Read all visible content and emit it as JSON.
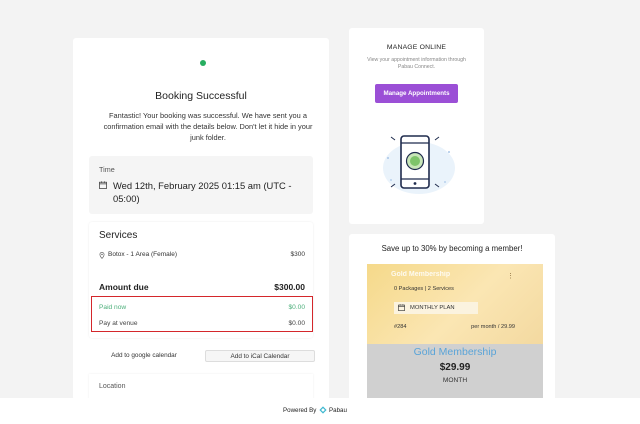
{
  "booking": {
    "title": "Booking Successful",
    "message": "Fantastic! Your booking was successful. We have sent you a confirmation email with the details below. Don't let it hide in your junk folder.",
    "time_label": "Time",
    "time_value": "Wed 12th,  February 2025 01:15 am (UTC - 05:00)",
    "services_title": "Services",
    "service": {
      "name": "Botox - 1 Area (Female)",
      "price": "$300"
    },
    "amount_due_label": "Amount due",
    "amount_due_value": "$300.00",
    "paid_now_label": "Paid now",
    "paid_now_value": "$0.00",
    "pay_at_venue_label": "Pay at venue",
    "pay_at_venue_value": "$0.00",
    "google_calendar_label": "Add to google calendar",
    "ical_label": "Add to iCal Calendar",
    "location_label": "Location"
  },
  "manage": {
    "title": "MANAGE ONLINE",
    "subtitle": "View your appointment information through Pabau Connect.",
    "button_label": "Manage Appointments"
  },
  "membership": {
    "heading": "Save up to 30% by becoming a member!",
    "card_name": "Gold Membership",
    "packages": "0 Packages | 2 Services",
    "plan": "MONTHLY PLAN",
    "number": "#284",
    "period": "per month / 29.99",
    "name": "Gold Membership",
    "price": "$29.99",
    "cycle": "MONTH"
  },
  "footer": {
    "powered_by": "Powered By",
    "brand": "Pabau"
  },
  "colors": {
    "success_green": "#27ae60",
    "paid_green": "#4caf7a",
    "highlight_red": "#d4272b",
    "accent_purple": "#9b4fd6",
    "membership_blue": "#5aa4d8",
    "gold": "#f5d98a"
  },
  "icons": [
    "status-dot",
    "calendar-icon",
    "map-pin-icon",
    "phone-icon",
    "more-icon",
    "plan-calendar-icon",
    "pabau-logo-icon"
  ]
}
